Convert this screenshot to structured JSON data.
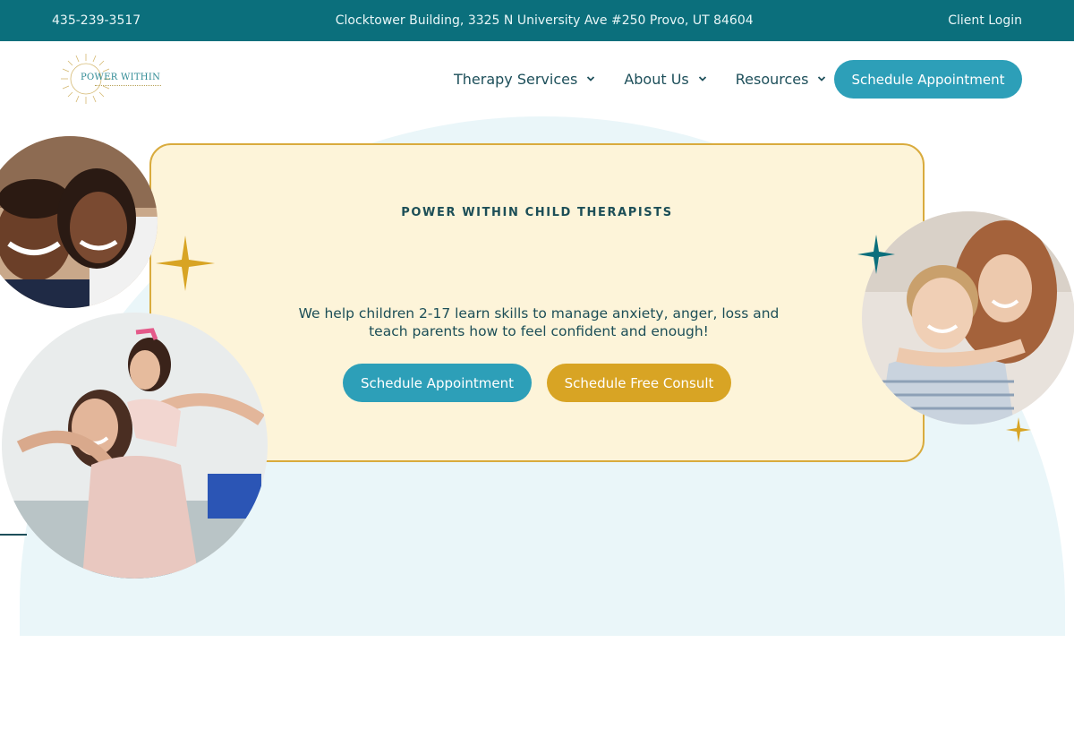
{
  "topbar": {
    "phone": "435-239-3517",
    "address": "Clocktower Building, 3325 N University Ave #250 Provo, UT 84604",
    "client_login": "Client Login"
  },
  "logo": {
    "text": "POWER WITHIN"
  },
  "nav": {
    "items": [
      {
        "label": "Therapy Services"
      },
      {
        "label": "About Us"
      },
      {
        "label": "Resources"
      }
    ],
    "cta": "Schedule Appointment"
  },
  "hero": {
    "eyebrow": "POWER WITHIN CHILD THERAPISTS",
    "text": "We help children 2-17 learn skills to manage anxiety, anger, loss and teach parents how to feel confident and enough!",
    "primary_button": "Schedule Appointment",
    "secondary_button": "Schedule Free Consult"
  },
  "colors": {
    "teal_dark": "#0b6f7c",
    "teal_button": "#2d9fb8",
    "gold": "#d8a424",
    "cream": "#fdf4d9",
    "arch": "#eaf6f9"
  }
}
